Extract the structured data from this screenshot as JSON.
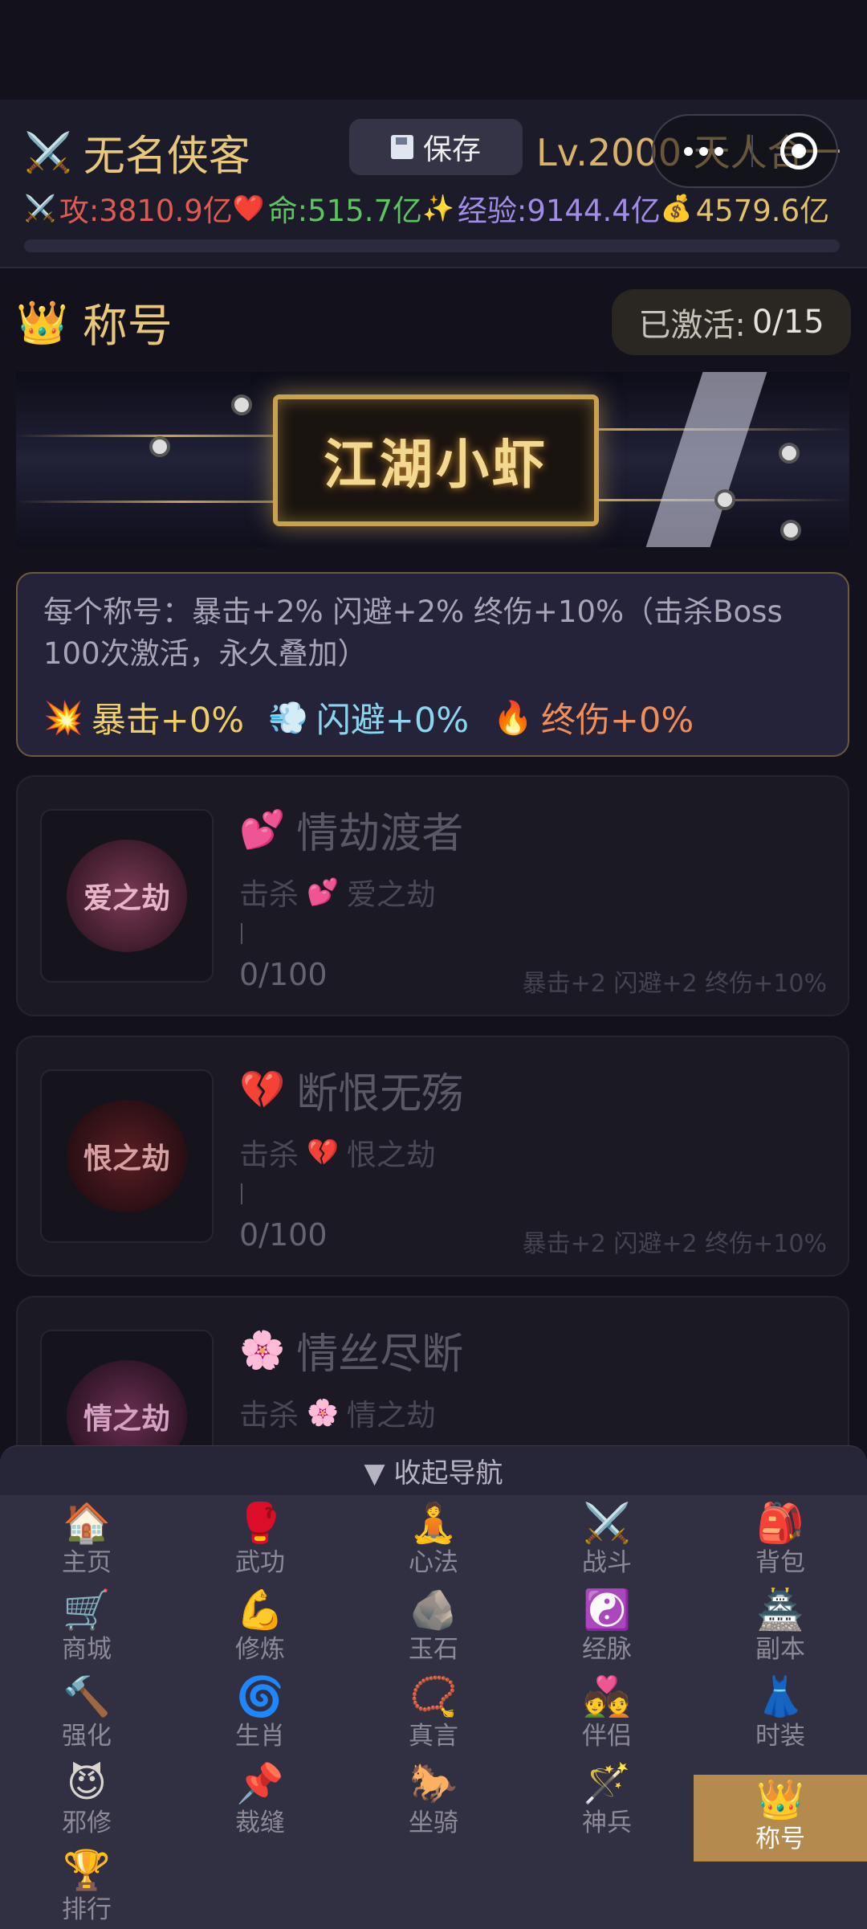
{
  "header": {
    "swords_icon": "⚔️",
    "player_name": "无名侠客",
    "save_label": "保存",
    "level_text": "Lv.2000 天人合一",
    "stats": {
      "attack_icon": "⚔️",
      "attack": "攻:3810.9亿",
      "hp_icon": "❤️",
      "hp": "命:515.7亿",
      "exp_icon": "✨",
      "exp": "经验:9144.4亿",
      "gold_icon": "💰",
      "gold": "4579.6亿"
    }
  },
  "titles_section": {
    "crown_icon": "👑",
    "heading": "称号",
    "activated_label": "已激活:",
    "activated_value": "0/15",
    "banner_title": "江湖小虾",
    "bonus_description": "每个称号：暴击+2% 闪避+2% 终伤+10%（击杀Boss 100次激活，永久叠加）",
    "bonuses": {
      "crit_icon": "💥",
      "crit": "暴击+0%",
      "dodge_icon": "💨",
      "dodge": "闪避+0%",
      "final_icon": "🔥",
      "final": "终伤+0%"
    }
  },
  "title_cards": [
    {
      "icon": "💕",
      "name": "情劫渡者",
      "kill_label": "击杀",
      "boss_icon": "💕",
      "boss": "爱之劫",
      "count": "0/100",
      "reward": "暴击+2 闪避+2 终伤+10%",
      "thumb_text": "爱之劫",
      "accent": "#8a2f55"
    },
    {
      "icon": "💔",
      "name": "断恨无殇",
      "kill_label": "击杀",
      "boss_icon": "💔",
      "boss": "恨之劫",
      "count": "0/100",
      "reward": "暴击+2 闪避+2 终伤+10%",
      "thumb_text": "恨之劫",
      "accent": "#7a1f26"
    },
    {
      "icon": "🌸",
      "name": "情丝尽断",
      "kill_label": "击杀",
      "boss_icon": "🌸",
      "boss": "情之劫",
      "count": "",
      "reward": "",
      "thumb_text": "情之劫",
      "accent": "#7d3a60"
    }
  ],
  "nav": {
    "collapse_label": "▼ 收起导航",
    "items": [
      {
        "icon": "🏠",
        "label": "主页"
      },
      {
        "icon": "🥊",
        "label": "武功"
      },
      {
        "icon": "🧘",
        "label": "心法"
      },
      {
        "icon": "⚔️",
        "label": "战斗"
      },
      {
        "icon": "🎒",
        "label": "背包"
      },
      {
        "icon": "🛒",
        "label": "商城"
      },
      {
        "icon": "💪",
        "label": "修炼"
      },
      {
        "icon": "🪨",
        "label": "玉石"
      },
      {
        "icon": "☯️",
        "label": "经脉"
      },
      {
        "icon": "🏯",
        "label": "副本"
      },
      {
        "icon": "🔨",
        "label": "强化"
      },
      {
        "icon": "🌀",
        "label": "生肖"
      },
      {
        "icon": "📿",
        "label": "真言"
      },
      {
        "icon": "💑",
        "label": "伴侣"
      },
      {
        "icon": "👗",
        "label": "时装"
      },
      {
        "icon": "😈",
        "label": "邪修"
      },
      {
        "icon": "📌",
        "label": "裁缝"
      },
      {
        "icon": "🐎",
        "label": "坐骑"
      },
      {
        "icon": "🪄",
        "label": "神兵"
      },
      {
        "icon": "👑",
        "label": "称号"
      },
      {
        "icon": "🏆",
        "label": "排行"
      }
    ],
    "active_label": "称号",
    "active_color": "#b48a4e"
  }
}
